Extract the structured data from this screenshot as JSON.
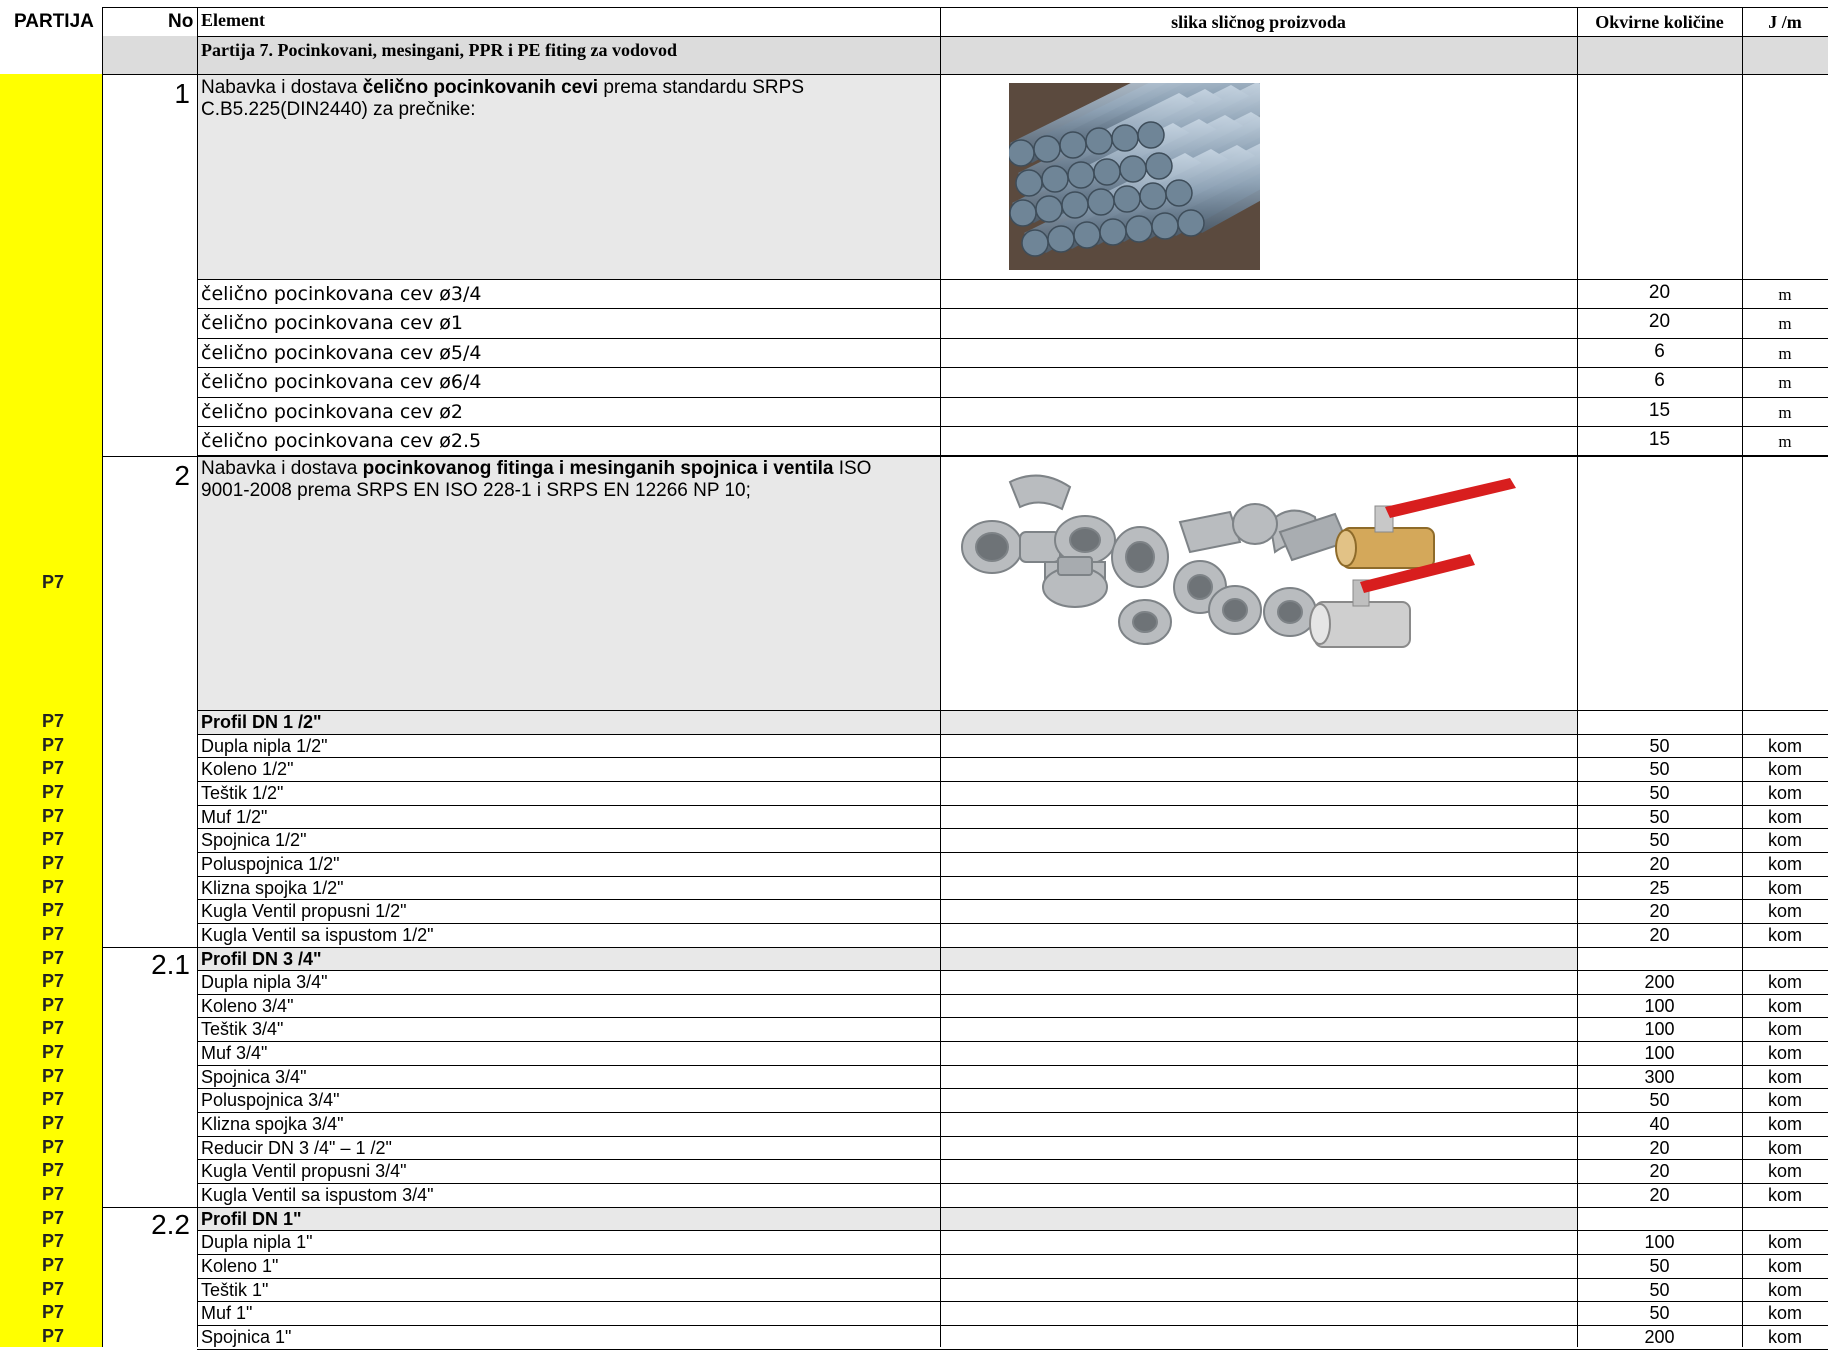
{
  "header": {
    "partija": "PARTIJA",
    "no": "No",
    "element": "Element",
    "slika": "slika sličnog proizvoda",
    "okvirne": "Okvirne količine",
    "jm": "J /m"
  },
  "section_title": "Partija 7.  Pocinkovani, mesingani, PPR i PE fiting za vodovod",
  "item1": {
    "no": "1",
    "desc_pre": "Nabavka i dostava ",
    "desc_bold": "čelično pocinkovanih cevi",
    "desc_post": " prema standardu SRPS",
    "desc_line2": "C.B5.225(DIN2440) za prečnike:",
    "image_name": "galvanized-steel-pipes-photo"
  },
  "pipes": [
    {
      "name": "čelično pocinkovana cev ø3/4",
      "qty": "20",
      "unit": "m"
    },
    {
      "name": "čelično pocinkovana cev ø1",
      "qty": "20",
      "unit": "m"
    },
    {
      "name": "čelično pocinkovana cev ø5/4",
      "qty": "6",
      "unit": "m"
    },
    {
      "name": "čelično pocinkovana cev ø6/4",
      "qty": "6",
      "unit": "m"
    },
    {
      "name": "čelično pocinkovana cev ø2",
      "qty": "15",
      "unit": "m"
    },
    {
      "name": "čelično pocinkovana cev ø2.5",
      "qty": "15",
      "unit": "m"
    }
  ],
  "item2": {
    "no": "2",
    "desc_pre": "Nabavka i dostava ",
    "desc_bold": "pocinkovanog fitinga i mesinganih spojnica i ventila",
    "desc_post": " ISO",
    "desc_line2": "9001-2008 prema SRPS EN ISO 228-1 i SRPS EN 12266 NP 10;",
    "partija": "P7",
    "image_name": "fittings-and-ball-valves-photo"
  },
  "groups": [
    {
      "no": "",
      "title": "Profil DN 1 /2\"",
      "partija": "P7",
      "rows": [
        {
          "name": "Dupla nipla 1/2\"",
          "qty": "50",
          "unit": "kom",
          "partija": "P7"
        },
        {
          "name": "Koleno 1/2\"",
          "qty": "50",
          "unit": "kom",
          "partija": "P7"
        },
        {
          "name": "Teštik 1/2\"",
          "qty": "50",
          "unit": "kom",
          "partija": "P7"
        },
        {
          "name": "Muf 1/2\"",
          "qty": "50",
          "unit": "kom",
          "partija": "P7"
        },
        {
          "name": "Spojnica 1/2\"",
          "qty": "50",
          "unit": "kom",
          "partija": "P7"
        },
        {
          "name": "Poluspojnica 1/2\"",
          "qty": "20",
          "unit": "kom",
          "partija": "P7"
        },
        {
          "name": "Klizna spojka 1/2\"",
          "qty": "25",
          "unit": "kom",
          "partija": "P7"
        },
        {
          "name": "Kugla Ventil propusni 1/2\"",
          "qty": "20",
          "unit": "kom",
          "partija": "P7"
        },
        {
          "name": "Kugla Ventil sa ispustom 1/2\"",
          "qty": "20",
          "unit": "kom",
          "partija": "P7"
        }
      ]
    },
    {
      "no": "2.1",
      "title": "Profil DN 3 /4\"",
      "partija": "P7",
      "rows": [
        {
          "name": "Dupla nipla 3/4\"",
          "qty": "200",
          "unit": "kom",
          "partija": "P7"
        },
        {
          "name": "Koleno 3/4\"",
          "qty": "100",
          "unit": "kom",
          "partija": "P7"
        },
        {
          "name": "Teštik 3/4\"",
          "qty": "100",
          "unit": "kom",
          "partija": "P7"
        },
        {
          "name": "Muf 3/4\"",
          "qty": "100",
          "unit": "kom",
          "partija": "P7"
        },
        {
          "name": "Spojnica 3/4\"",
          "qty": "300",
          "unit": "kom",
          "partija": "P7"
        },
        {
          "name": "Poluspojnica 3/4\"",
          "qty": "50",
          "unit": "kom",
          "partija": "P7"
        },
        {
          "name": "Klizna spojka 3/4\"",
          "qty": "40",
          "unit": "kom",
          "partija": "P7"
        },
        {
          "name": "Reducir DN 3 /4\" – 1 /2\"",
          "qty": "20",
          "unit": "kom",
          "partija": "P7"
        },
        {
          "name": "Kugla Ventil propusni 3/4\"",
          "qty": "20",
          "unit": "kom",
          "partija": "P7"
        },
        {
          "name": "Kugla Ventil sa ispustom 3/4\"",
          "qty": "20",
          "unit": "kom",
          "partija": "P7"
        }
      ]
    },
    {
      "no": "2.2",
      "title": "Profil DN 1\"",
      "partija": "P7",
      "rows": [
        {
          "name": "Dupla nipla 1\"",
          "qty": "100",
          "unit": "kom",
          "partija": "P7"
        },
        {
          "name": "Koleno 1\"",
          "qty": "50",
          "unit": "kom",
          "partija": "P7"
        },
        {
          "name": "Teštik 1\"",
          "qty": "50",
          "unit": "kom",
          "partija": "P7"
        },
        {
          "name": "Muf 1\"",
          "qty": "50",
          "unit": "kom",
          "partija": "P7"
        },
        {
          "name": "Spojnica 1\"",
          "qty": "200",
          "unit": "kom",
          "partija": "P7"
        }
      ]
    }
  ],
  "colors": {
    "partija_highlight": "#ffff00",
    "header_fill": "#dcdcdc",
    "description_fill": "#e8e8e8",
    "valve_handle": "#d81e1e"
  }
}
